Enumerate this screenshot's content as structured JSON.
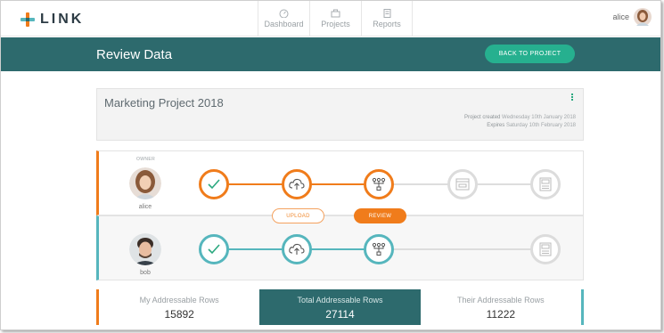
{
  "app": {
    "logo_text": "LINK"
  },
  "nav": {
    "tabs": [
      {
        "label": "Dashboard",
        "icon": "dashboard-icon"
      },
      {
        "label": "Projects",
        "icon": "briefcase-icon"
      },
      {
        "label": "Reports",
        "icon": "report-icon"
      }
    ],
    "user_name": "alice"
  },
  "header": {
    "title": "Review Data",
    "back_button": "BACK TO PROJECT"
  },
  "project": {
    "title": "Marketing Project 2018",
    "created_label": "Project created",
    "created_value": "Wednesday 10th January 2018",
    "expires_label": "Expires",
    "expires_value": "Saturday 10th February 2018"
  },
  "workflow": {
    "owner_tag": "OWNER",
    "owner_name": "alice",
    "partner_name": "bob",
    "upload_label": "UPLOAD",
    "review_label": "REVIEW"
  },
  "stats": {
    "mine_label": "My Addressable Rows",
    "mine_value": "15892",
    "total_label": "Total Addressable Rows",
    "total_value": "27114",
    "theirs_label": "Their Addressable Rows",
    "theirs_value": "11222"
  },
  "colors": {
    "accent_orange": "#f07c1b",
    "accent_teal": "#56b6bd",
    "header_teal": "#2d6a6d",
    "button_green": "#26b08f"
  }
}
